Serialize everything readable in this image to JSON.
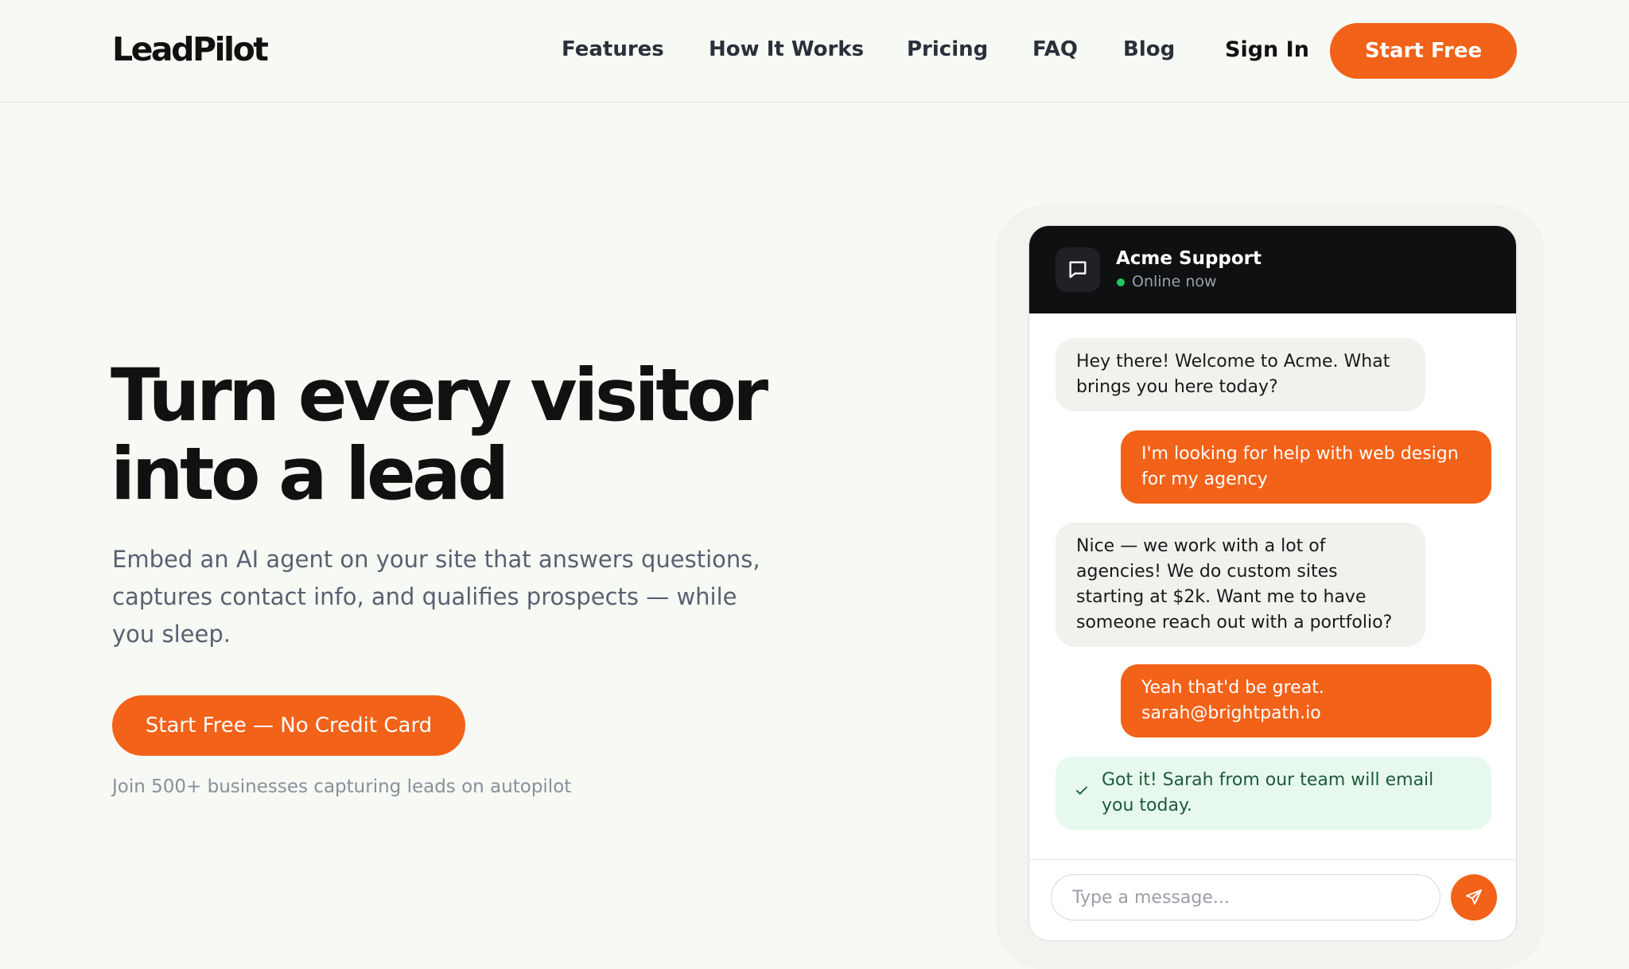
{
  "brand": {
    "name": "LeadPilot"
  },
  "nav": {
    "links": [
      "Features",
      "How It Works",
      "Pricing",
      "FAQ",
      "Blog"
    ],
    "sign_in": "Sign In",
    "start_free": "Start Free"
  },
  "hero": {
    "title_line1": "Turn every visitor",
    "title_line2": "into a lead",
    "subtitle": "Embed an AI agent on your site that answers questions, captures contact info, and qualifies prospects — while you sleep.",
    "cta": "Start Free — No Credit Card",
    "social_proof": "Join 500+ businesses capturing leads on autopilot"
  },
  "chat": {
    "name": "Acme Support",
    "status": "Online now",
    "messages": [
      {
        "from": "bot",
        "text": "Hey there! Welcome to Acme. What brings you here today?"
      },
      {
        "from": "user",
        "text": "I'm looking for help with web design for my agency"
      },
      {
        "from": "bot",
        "text": "Nice — we work with a lot of agencies! We do custom sites starting at $2k. Want me to have someone reach out with a portfolio?"
      },
      {
        "from": "user",
        "text": "Yeah that'd be great. sarah@brightpath.io"
      },
      {
        "from": "confirm",
        "text": "Got it! Sarah from our team will email you today."
      }
    ],
    "input_placeholder": "Type a message..."
  },
  "colors": {
    "accent": "#f26218",
    "background": "#f7f9f4",
    "chat_header": "#0f1012",
    "online": "#22c55e",
    "confirm_bg": "#e7f9ee"
  },
  "icons": {
    "chat_avatar": "message-square-icon",
    "confirm": "check-icon",
    "send": "send-icon"
  }
}
